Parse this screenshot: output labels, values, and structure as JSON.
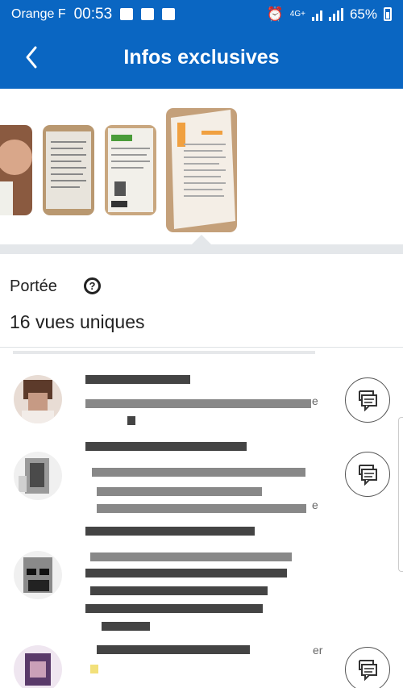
{
  "status_bar": {
    "carrier": "Orange F",
    "time": "00:53",
    "network": "4G+",
    "battery": "65%"
  },
  "app_bar": {
    "title": "Infos exclusives",
    "back_icon": "chevron-left-icon"
  },
  "reach": {
    "label": "Portée",
    "help_icon": "question-circle-icon",
    "value": "16 vues uniques"
  },
  "list": {
    "message_icon": "message-icon",
    "tails": [
      "e",
      "e",
      "er"
    ]
  }
}
